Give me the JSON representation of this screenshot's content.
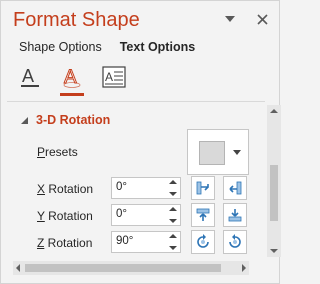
{
  "pane": {
    "title": "Format Shape",
    "tabs": [
      {
        "label": "Shape Options",
        "active": false
      },
      {
        "label": "Text Options",
        "active": true
      }
    ],
    "icon_tabs": [
      {
        "name": "text-fill-outline-icon",
        "selected": false
      },
      {
        "name": "text-effects-icon",
        "selected": true
      },
      {
        "name": "textbox-icon",
        "selected": false
      }
    ]
  },
  "section": {
    "title": "3-D Rotation",
    "presets_label": "Presets",
    "presets_underline": "P",
    "presets_rest": "resets"
  },
  "rotations": [
    {
      "letter": "X",
      "rest": " Rotation",
      "value": "0°"
    },
    {
      "letter": "Y",
      "rest": " Rotation",
      "value": "0°"
    },
    {
      "letter": "Z",
      "rest": " Rotation",
      "value": "90°"
    }
  ],
  "colors": {
    "accent": "#c43e1c",
    "rotate_icon": "#2e75b6"
  }
}
